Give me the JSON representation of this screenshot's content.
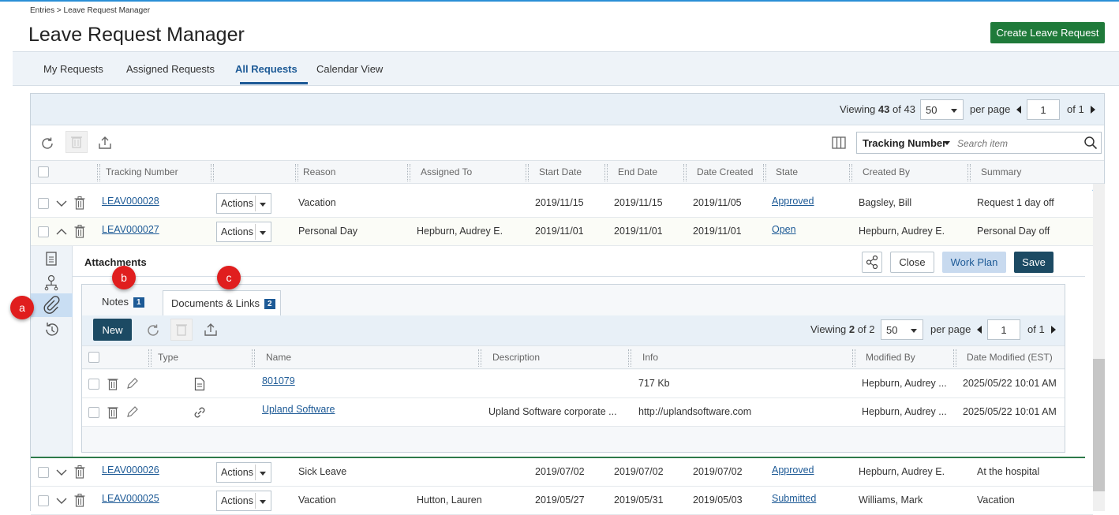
{
  "breadcrumb": "Entries > Leave Request Manager",
  "page_title": "Leave Request Manager",
  "create_button": "Create Leave Request",
  "tabs": [
    {
      "label": "My Requests",
      "active": false
    },
    {
      "label": "Assigned Requests",
      "active": false
    },
    {
      "label": "All Requests",
      "active": true
    },
    {
      "label": "Calendar View",
      "active": false
    }
  ],
  "pager": {
    "viewing_label": "Viewing",
    "count": "43",
    "of_label": "of",
    "total": "43",
    "per_page_value": "50",
    "per_page_label": "per page",
    "page": "1",
    "page_of": "of 1"
  },
  "search": {
    "field": "Tracking Number",
    "placeholder": "Search item"
  },
  "columns": [
    "Tracking Number",
    "Reason",
    "Assigned To",
    "Start Date",
    "End Date",
    "Date Created",
    "State",
    "Created By",
    "Summary"
  ],
  "actions_label": "Actions",
  "rows_top": [
    {
      "tracking": "LEAV000028",
      "reason": "Vacation",
      "assigned": "",
      "start": "2019/11/15",
      "end": "2019/11/15",
      "created": "2019/11/05",
      "state": "Approved",
      "created_by": "Bagsley, Bill",
      "summary": "Request 1 day off"
    },
    {
      "tracking": "LEAV000027",
      "reason": "Personal Day",
      "assigned": "Hepburn, Audrey E.",
      "start": "2019/11/01",
      "end": "2019/11/01",
      "created": "2019/11/01",
      "state": "Open",
      "created_by": "Hepburn, Audrey E.",
      "summary": "Personal Day off"
    }
  ],
  "attachments": {
    "title": "Attachments",
    "close": "Close",
    "work_plan": "Work Plan",
    "save": "Save",
    "tabs": [
      {
        "label": "Notes",
        "count": "1"
      },
      {
        "label": "Documents & Links",
        "count": "2"
      }
    ],
    "new_button": "New",
    "pager": {
      "viewing_label": "Viewing",
      "count": "2",
      "of_label": "of",
      "total": "2",
      "per_page_value": "50",
      "per_page_label": "per page",
      "page": "1",
      "page_of": "of 1"
    },
    "columns": [
      "Type",
      "Name",
      "Description",
      "Info",
      "Modified By",
      "Date Modified (EST)"
    ],
    "rows": [
      {
        "type_icon": "document-icon",
        "name": "801079",
        "description": "",
        "info": "717 Kb",
        "modified_by": "Hepburn, Audrey ...",
        "date_modified": "2025/05/22 10:01 AM"
      },
      {
        "type_icon": "link-icon",
        "name": "Upland Software",
        "description": "Upland Software corporate ...",
        "info": "http://uplandsoftware.com",
        "modified_by": "Hepburn, Audrey ...",
        "date_modified": "2025/05/22 10:01 AM"
      }
    ]
  },
  "rows_bottom": [
    {
      "tracking": "LEAV000026",
      "reason": "Sick Leave",
      "assigned": "",
      "start": "2019/07/02",
      "end": "2019/07/02",
      "created": "2019/07/02",
      "state": "Approved",
      "created_by": "Hepburn, Audrey E.",
      "summary": "At the hospital"
    },
    {
      "tracking": "LEAV000025",
      "reason": "Vacation",
      "assigned": "Hutton, Lauren",
      "start": "2019/05/27",
      "end": "2019/05/31",
      "created": "2019/05/03",
      "state": "Submitted",
      "created_by": "Williams, Mark",
      "summary": "Vacation"
    }
  ],
  "callouts": [
    "a",
    "b",
    "c"
  ],
  "colors": {
    "primary": "#1d5a96",
    "create_green": "#1f7a3a",
    "save_dark": "#1c4a63",
    "callout_red": "#e01e1e"
  }
}
